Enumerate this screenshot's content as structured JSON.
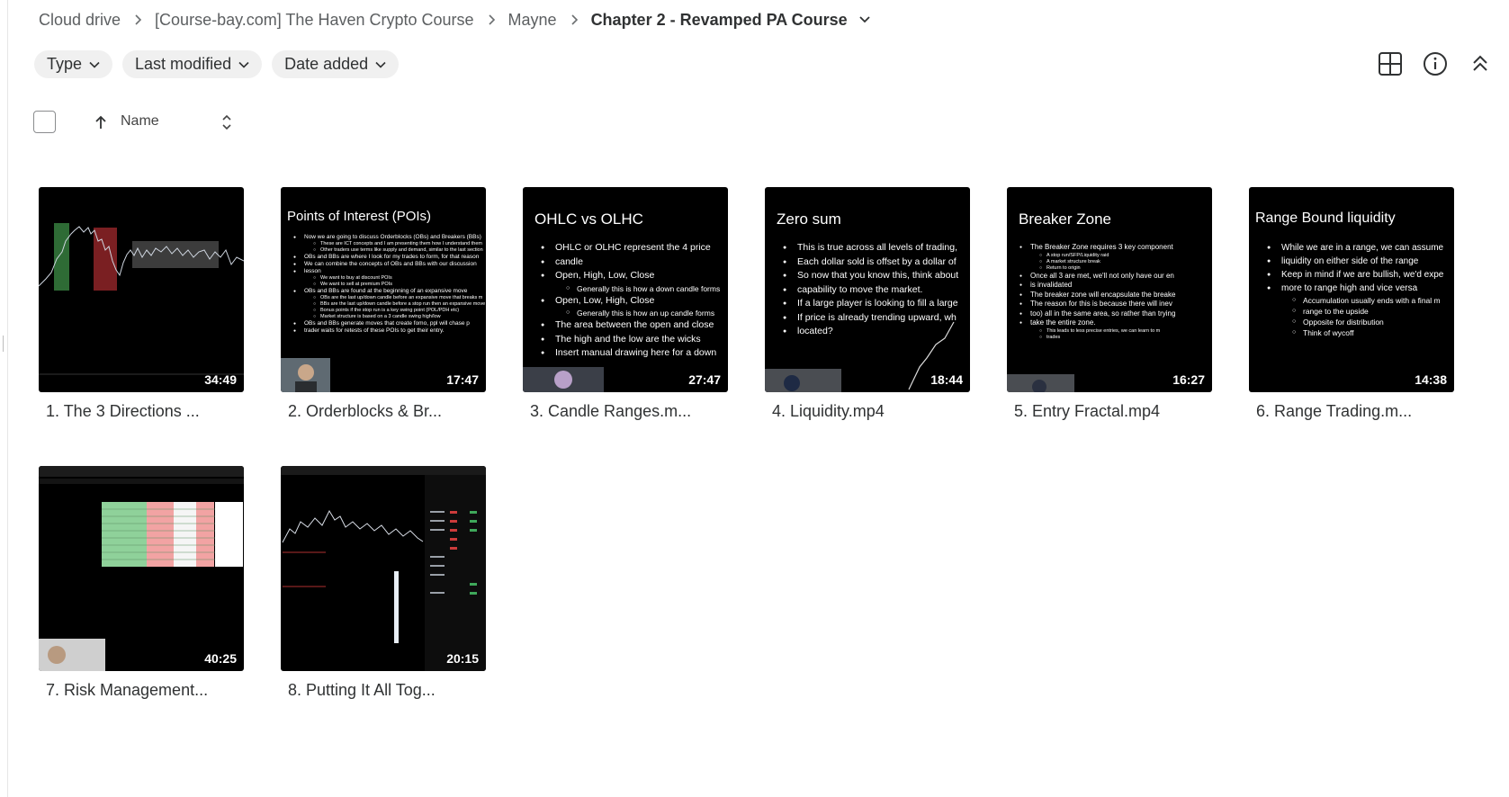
{
  "breadcrumb": {
    "items": [
      "Cloud drive",
      "[Course-bay.com] The Haven Crypto Course",
      "Mayne"
    ],
    "current": "Chapter 2 - Revamped PA Course"
  },
  "filters": [
    {
      "label": "Type"
    },
    {
      "label": "Last modified"
    },
    {
      "label": "Date added"
    }
  ],
  "toolbar": {
    "icons": [
      "grid-view-icon",
      "info-icon",
      "collapse-icon"
    ]
  },
  "list_header": {
    "name_label": "Name",
    "sort": "ascending"
  },
  "files": [
    {
      "name": "1. The 3 Directions ...",
      "duration": "34:49",
      "slide_title": "",
      "bullets": []
    },
    {
      "name": "2. Orderblocks & Br...",
      "duration": "17:47",
      "slide_title": "Points of Interest (POIs)",
      "bullets": [
        {
          "t": "Now we are going to discuss Orderblocks (OBs) and Breakers (BBs)",
          "sub": false
        },
        {
          "t": "These are ICT concepts and I am presenting them how I understand them",
          "sub": true
        },
        {
          "t": "Other traders use terms like supply and demand, similar to the last section",
          "sub": true
        },
        {
          "t": "OBs and BBs are where I look for my trades to form, for that reason",
          "sub": false
        },
        {
          "t": "We can combine the concepts of OBs and BBs with our discussion",
          "sub": false
        },
        {
          "t": "lesson",
          "sub": false
        },
        {
          "t": "We want to buy at discount POIs",
          "sub": true
        },
        {
          "t": "We want to sell at premium POIs",
          "sub": true
        },
        {
          "t": "OBs and BBs are found at the beginning of an expansive move",
          "sub": false
        },
        {
          "t": "OBs are the last up/down candle before an expansive move that breaks m",
          "sub": true
        },
        {
          "t": "BBs are the last up/down candle before a stop run then an expansive move",
          "sub": true
        },
        {
          "t": "Bonus points if the stop run is a key swing point (POL/PDH etc)",
          "sub": true
        },
        {
          "t": "Market structure is based on a 3 candle swing high/low",
          "sub": true
        },
        {
          "t": "OBs and BBs generate moves that create fomo, ppl will chase p",
          "sub": false
        },
        {
          "t": "trader waits for retests of these POIs to get their entry.",
          "sub": false
        }
      ]
    },
    {
      "name": "3. Candle Ranges.m...",
      "duration": "27:47",
      "slide_title": "OHLC vs OLHC",
      "bullets": [
        {
          "t": "OHLC or OLHC represent the 4 price",
          "sub": false
        },
        {
          "t": "candle",
          "sub": false
        },
        {
          "t": "Open, High, Low, Close",
          "sub": false
        },
        {
          "t": "Generally this is how a down candle forms",
          "sub": true
        },
        {
          "t": "Open, Low, High, Close",
          "sub": false
        },
        {
          "t": "Generally this is how an up candle forms",
          "sub": true
        },
        {
          "t": "The area between the open and close",
          "sub": false
        },
        {
          "t": "The high and the low are the wicks",
          "sub": false
        },
        {
          "t": "Insert manual drawing here for a down",
          "sub": false
        }
      ]
    },
    {
      "name": "4. Liquidity.mp4",
      "duration": "18:44",
      "slide_title": "Zero sum",
      "bullets": [
        {
          "t": "This is true across all levels of trading,",
          "sub": false
        },
        {
          "t": "Each dollar sold is offset by a dollar of",
          "sub": false
        },
        {
          "t": "So now that you know this, think about",
          "sub": false
        },
        {
          "t": "capability to move the market.",
          "sub": false
        },
        {
          "t": "If a large player is looking to fill a large",
          "sub": false
        },
        {
          "t": "If price is already trending upward, wh",
          "sub": false
        },
        {
          "t": "located?",
          "sub": false
        }
      ]
    },
    {
      "name": "5. Entry Fractal.mp4",
      "duration": "16:27",
      "slide_title": "Breaker Zone",
      "bullets": [
        {
          "t": "The Breaker Zone requires 3 key component",
          "sub": false
        },
        {
          "t": "A stop run/SFP/Liquidity raid",
          "sub": true
        },
        {
          "t": "A market structure break",
          "sub": true
        },
        {
          "t": "Return to origin",
          "sub": true
        },
        {
          "t": "Once all 3 are met, we'll not only have our en",
          "sub": false
        },
        {
          "t": "is invalidated",
          "sub": false
        },
        {
          "t": "The breaker zone will encapsulate the breake",
          "sub": false
        },
        {
          "t": "The reason for this is because there will inev",
          "sub": false
        },
        {
          "t": "too) all in the same area, so rather than trying",
          "sub": false
        },
        {
          "t": "take the entire zone.",
          "sub": false
        },
        {
          "t": "This leads to less precise entries, we can learn to m",
          "sub": true
        },
        {
          "t": "trades",
          "sub": true
        }
      ]
    },
    {
      "name": "6. Range Trading.m...",
      "duration": "14:38",
      "slide_title": "Range Bound liquidity",
      "bullets": [
        {
          "t": "While we are in a range, we can assume",
          "sub": false
        },
        {
          "t": "liquidity on either side of the range",
          "sub": false
        },
        {
          "t": "Keep in mind if we are bullish, we'd expe",
          "sub": false
        },
        {
          "t": "more to range high and vice versa",
          "sub": false
        },
        {
          "t": "Accumulation usually ends with a final m",
          "sub": true
        },
        {
          "t": "range to the upside",
          "sub": true
        },
        {
          "t": "Opposite for distribution",
          "sub": true
        },
        {
          "t": "Think of wycoff",
          "sub": true
        }
      ]
    },
    {
      "name": "7. Risk Management...",
      "duration": "40:25",
      "slide_title": "",
      "bullets": []
    },
    {
      "name": "8. Putting It All Tog...",
      "duration": "20:15",
      "slide_title": "",
      "bullets": []
    }
  ]
}
